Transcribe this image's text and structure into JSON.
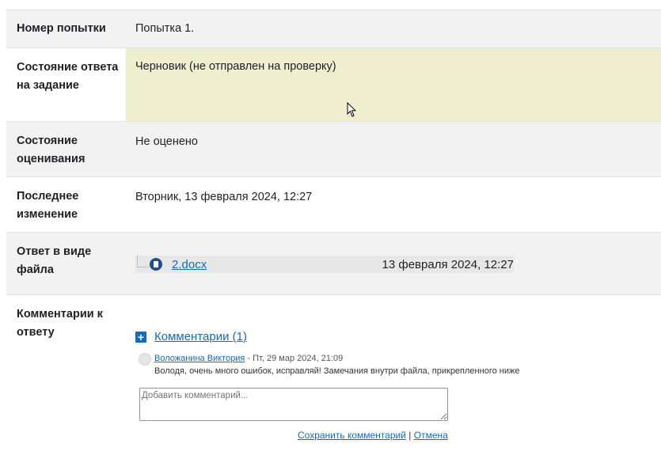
{
  "rows": {
    "attempt": {
      "label": "Номер попытки",
      "value": "Попытка 1."
    },
    "submission_status": {
      "label": "Состояние ответа на задание",
      "value": "Черновик (не отправлен на проверку)"
    },
    "grading_status": {
      "label": "Состояние оценивания",
      "value": "Не оценено"
    },
    "last_modified": {
      "label": "Последнее изменение",
      "value": "Вторник, 13 февраля 2024, 12:27"
    },
    "file_submission": {
      "label": "Ответ в виде файла",
      "file_name": "2.docx",
      "file_date": "13 февраля 2024, 12:27"
    },
    "comments": {
      "label": "Комментарии к ответу"
    }
  },
  "comments": {
    "toggle_label": "Комментарии (1)",
    "items": [
      {
        "author": "Воложанина Виктория",
        "separator": " - ",
        "date": "Пт, 29 мар 2024, 21:09",
        "text": "Володя, очень много ошибок, исправляй! Замечания внутри файла, прикрепленного ниже"
      }
    ],
    "input_placeholder": "Добавить комментарий...",
    "save_label": "Сохранить комментарий",
    "divider": "|",
    "cancel_label": "Отмена"
  },
  "icons": [
    "docx-file-icon",
    "expand-plus-icon",
    "user-avatar-icon",
    "mouse-cursor-icon"
  ],
  "colors": {
    "link": "#0f6cbf",
    "draft_background": "#efefcf",
    "row_gray": "#f2f2f2"
  }
}
